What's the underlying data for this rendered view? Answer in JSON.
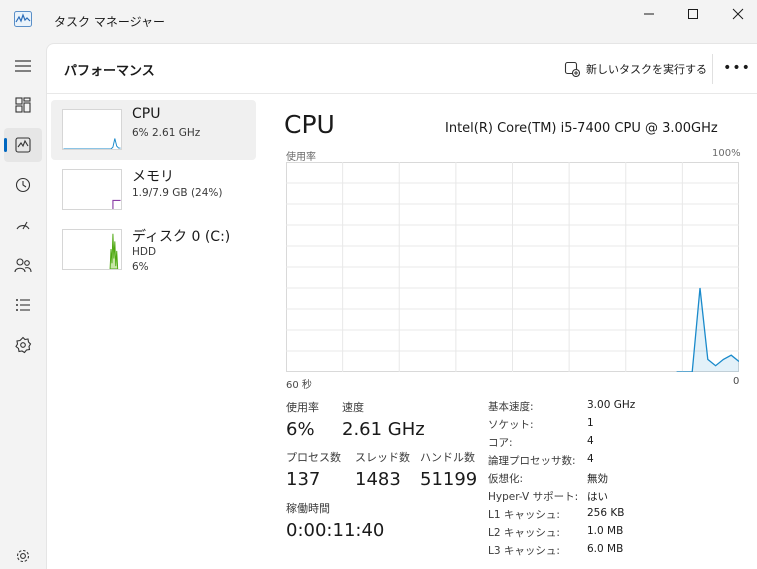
{
  "window": {
    "title": "タスク マネージャー"
  },
  "header": {
    "title": "パフォーマンス",
    "run_task_label": "新しいタスクを実行する",
    "more_label": "•••"
  },
  "nav": {
    "items": [
      {
        "name": "menu-icon"
      },
      {
        "name": "processes-icon"
      },
      {
        "name": "performance-icon",
        "active": true
      },
      {
        "name": "app-history-icon"
      },
      {
        "name": "startup-icon"
      },
      {
        "name": "users-icon"
      },
      {
        "name": "details-icon"
      },
      {
        "name": "services-icon"
      }
    ],
    "settings_icon": "gear-icon"
  },
  "resources": [
    {
      "name": "CPU",
      "line1": "6%  2.61 GHz",
      "color": "#1a8acb",
      "active": true
    },
    {
      "name": "メモリ",
      "line1": "1.9/7.9 GB (24%)",
      "color": "#8b3fa6"
    },
    {
      "name": "ディスク 0 (C:)",
      "line1": "HDD",
      "line2": "6%",
      "color": "#4da80f"
    }
  ],
  "detail": {
    "title": "CPU",
    "model": "Intel(R) Core(TM) i5-7400 CPU @ 3.00GHz",
    "util_label": "使用率",
    "max_label": "100%",
    "time_left": "60 秒",
    "time_right": "0",
    "stats": {
      "utilization_label": "使用率",
      "utilization_value": "6%",
      "speed_label": "速度",
      "speed_value": "2.61 GHz",
      "processes_label": "プロセス数",
      "processes_value": "137",
      "threads_label": "スレッド数",
      "threads_value": "1483",
      "handles_label": "ハンドル数",
      "handles_value": "51199",
      "uptime_label": "稼働時間",
      "uptime_value": "0:00:11:40"
    },
    "specs": [
      {
        "label": "基本速度:",
        "value": "3.00 GHz"
      },
      {
        "label": "ソケット:",
        "value": "1"
      },
      {
        "label": "コア:",
        "value": "4"
      },
      {
        "label": "論理プロセッサ数:",
        "value": "4"
      },
      {
        "label": "仮想化:",
        "value": "無効"
      },
      {
        "label": "Hyper-V サポート:",
        "value": "はい"
      },
      {
        "label": "L1 キャッシュ:",
        "value": "256 KB"
      },
      {
        "label": "L2 キャッシュ:",
        "value": "1.0 MB"
      },
      {
        "label": "L3 キャッシュ:",
        "value": "6.0 MB"
      }
    ]
  },
  "chart_data": {
    "type": "line",
    "ylim": [
      0,
      100
    ],
    "grid": true,
    "series": [
      {
        "values_recent": [
          0,
          0,
          0,
          40,
          6,
          3,
          6,
          8,
          5
        ],
        "color": "#1a8acb"
      }
    ]
  }
}
